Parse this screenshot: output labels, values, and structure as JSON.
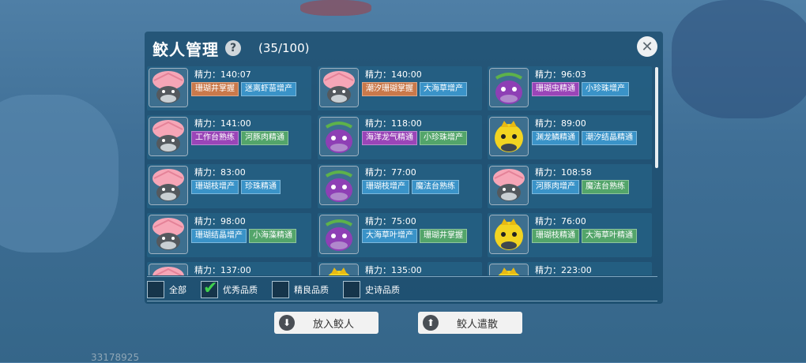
{
  "header": {
    "title": "鲛人管理",
    "help_icon": "?",
    "count": "(35/100)",
    "close_icon": "close-icon"
  },
  "colors": {
    "orange_tag": "#c9794b",
    "blue_tag": "#3a93c8",
    "purple_tag": "#9a45b8",
    "green_tag": "#53a56a"
  },
  "cards": [
    {
      "type": "shell",
      "stamina": "精力：140:07",
      "tags": [
        {
          "t": "珊瑚井掌握",
          "c": "orange"
        },
        {
          "t": "迷离虾苗增产",
          "c": "blue"
        }
      ]
    },
    {
      "type": "shell",
      "stamina": "精力：140:00",
      "tags": [
        {
          "t": "潮汐珊瑚掌握",
          "c": "orange"
        },
        {
          "t": "大海草增产",
          "c": "blue"
        }
      ]
    },
    {
      "type": "purple",
      "stamina": "精力：96:03",
      "tags": [
        {
          "t": "珊瑚虫精通",
          "c": "purple"
        },
        {
          "t": "小珍珠增产",
          "c": "blue"
        }
      ]
    },
    {
      "type": "shell",
      "stamina": "精力：141:00",
      "tags": [
        {
          "t": "工作台熟练",
          "c": "purple"
        },
        {
          "t": "河豚肉精通",
          "c": "green"
        }
      ]
    },
    {
      "type": "purple",
      "stamina": "精力：118:00",
      "tags": [
        {
          "t": "海洋龙气精通",
          "c": "purple"
        },
        {
          "t": "小珍珠增产",
          "c": "green"
        }
      ]
    },
    {
      "type": "yellow",
      "stamina": "精力：89:00",
      "tags": [
        {
          "t": "渊龙鳞精通",
          "c": "blue"
        },
        {
          "t": "潮汐结晶精通",
          "c": "blue"
        }
      ]
    },
    {
      "type": "shell",
      "stamina": "精力：83:00",
      "tags": [
        {
          "t": "珊瑚枝增产",
          "c": "blue"
        },
        {
          "t": "珍珠精通",
          "c": "blue"
        }
      ]
    },
    {
      "type": "purple",
      "stamina": "精力：77:00",
      "tags": [
        {
          "t": "珊瑚枝增产",
          "c": "blue"
        },
        {
          "t": "魔法台熟练",
          "c": "blue"
        }
      ]
    },
    {
      "type": "shell",
      "stamina": "精力：108:58",
      "tags": [
        {
          "t": "河豚肉增产",
          "c": "blue"
        },
        {
          "t": "魔法台熟练",
          "c": "green"
        }
      ]
    },
    {
      "type": "shell",
      "stamina": "精力：98:00",
      "tags": [
        {
          "t": "珊瑚结晶增产",
          "c": "blue"
        },
        {
          "t": "小海藻精通",
          "c": "green"
        }
      ]
    },
    {
      "type": "purple",
      "stamina": "精力：75:00",
      "tags": [
        {
          "t": "大海草叶增产",
          "c": "blue"
        },
        {
          "t": "珊瑚井掌握",
          "c": "green"
        }
      ]
    },
    {
      "type": "yellow",
      "stamina": "精力：76:00",
      "tags": [
        {
          "t": "珊瑚枝精通",
          "c": "green"
        },
        {
          "t": "大海草叶精通",
          "c": "green"
        }
      ]
    },
    {
      "type": "shell",
      "stamina": "精力：137:00",
      "tags": []
    },
    {
      "type": "yellow",
      "stamina": "精力：135:00",
      "tags": []
    },
    {
      "type": "yellow",
      "stamina": "精力：223:00",
      "tags": []
    }
  ],
  "filters": [
    {
      "label": "全部",
      "checked": false
    },
    {
      "label": "优秀品质",
      "checked": true
    },
    {
      "label": "精良品质",
      "checked": false
    },
    {
      "label": "史诗品质",
      "checked": false
    }
  ],
  "buttons": {
    "add_label": "放入鲛人",
    "dismiss_label": "鲛人遣散"
  },
  "uid": "33178925"
}
